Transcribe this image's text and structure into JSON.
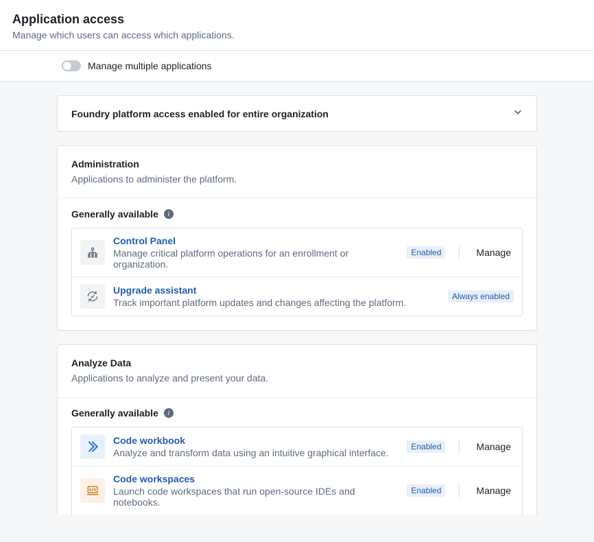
{
  "header": {
    "title": "Application access",
    "subtitle": "Manage which users can access which applications."
  },
  "toggle": {
    "label": "Manage multiple applications",
    "value": false
  },
  "banner": {
    "text": "Foundry platform access enabled for entire organization"
  },
  "labels": {
    "generally_available": "Generally available",
    "manage": "Manage"
  },
  "status": {
    "enabled": "Enabled",
    "always_enabled": "Always enabled"
  },
  "sections": [
    {
      "title": "Administration",
      "subtitle": "Applications to administer the platform.",
      "apps": [
        {
          "name": "Control Panel",
          "desc": "Manage critical platform operations for an enrollment or organization.",
          "status": "enabled",
          "manageable": true,
          "icon": "control-panel"
        },
        {
          "name": "Upgrade assistant",
          "desc": "Track important platform updates and changes affecting the platform.",
          "status": "always_enabled",
          "manageable": false,
          "icon": "upgrade-assistant"
        }
      ]
    },
    {
      "title": "Analyze Data",
      "subtitle": "Applications to analyze and present your data.",
      "apps": [
        {
          "name": "Code workbook",
          "desc": "Analyze and transform data using an intuitive graphical interface.",
          "status": "enabled",
          "manageable": true,
          "icon": "code-workbook"
        },
        {
          "name": "Code workspaces",
          "desc": "Launch code workspaces that run open-source IDEs and notebooks.",
          "status": "enabled",
          "manageable": true,
          "icon": "code-workspaces"
        }
      ]
    }
  ]
}
